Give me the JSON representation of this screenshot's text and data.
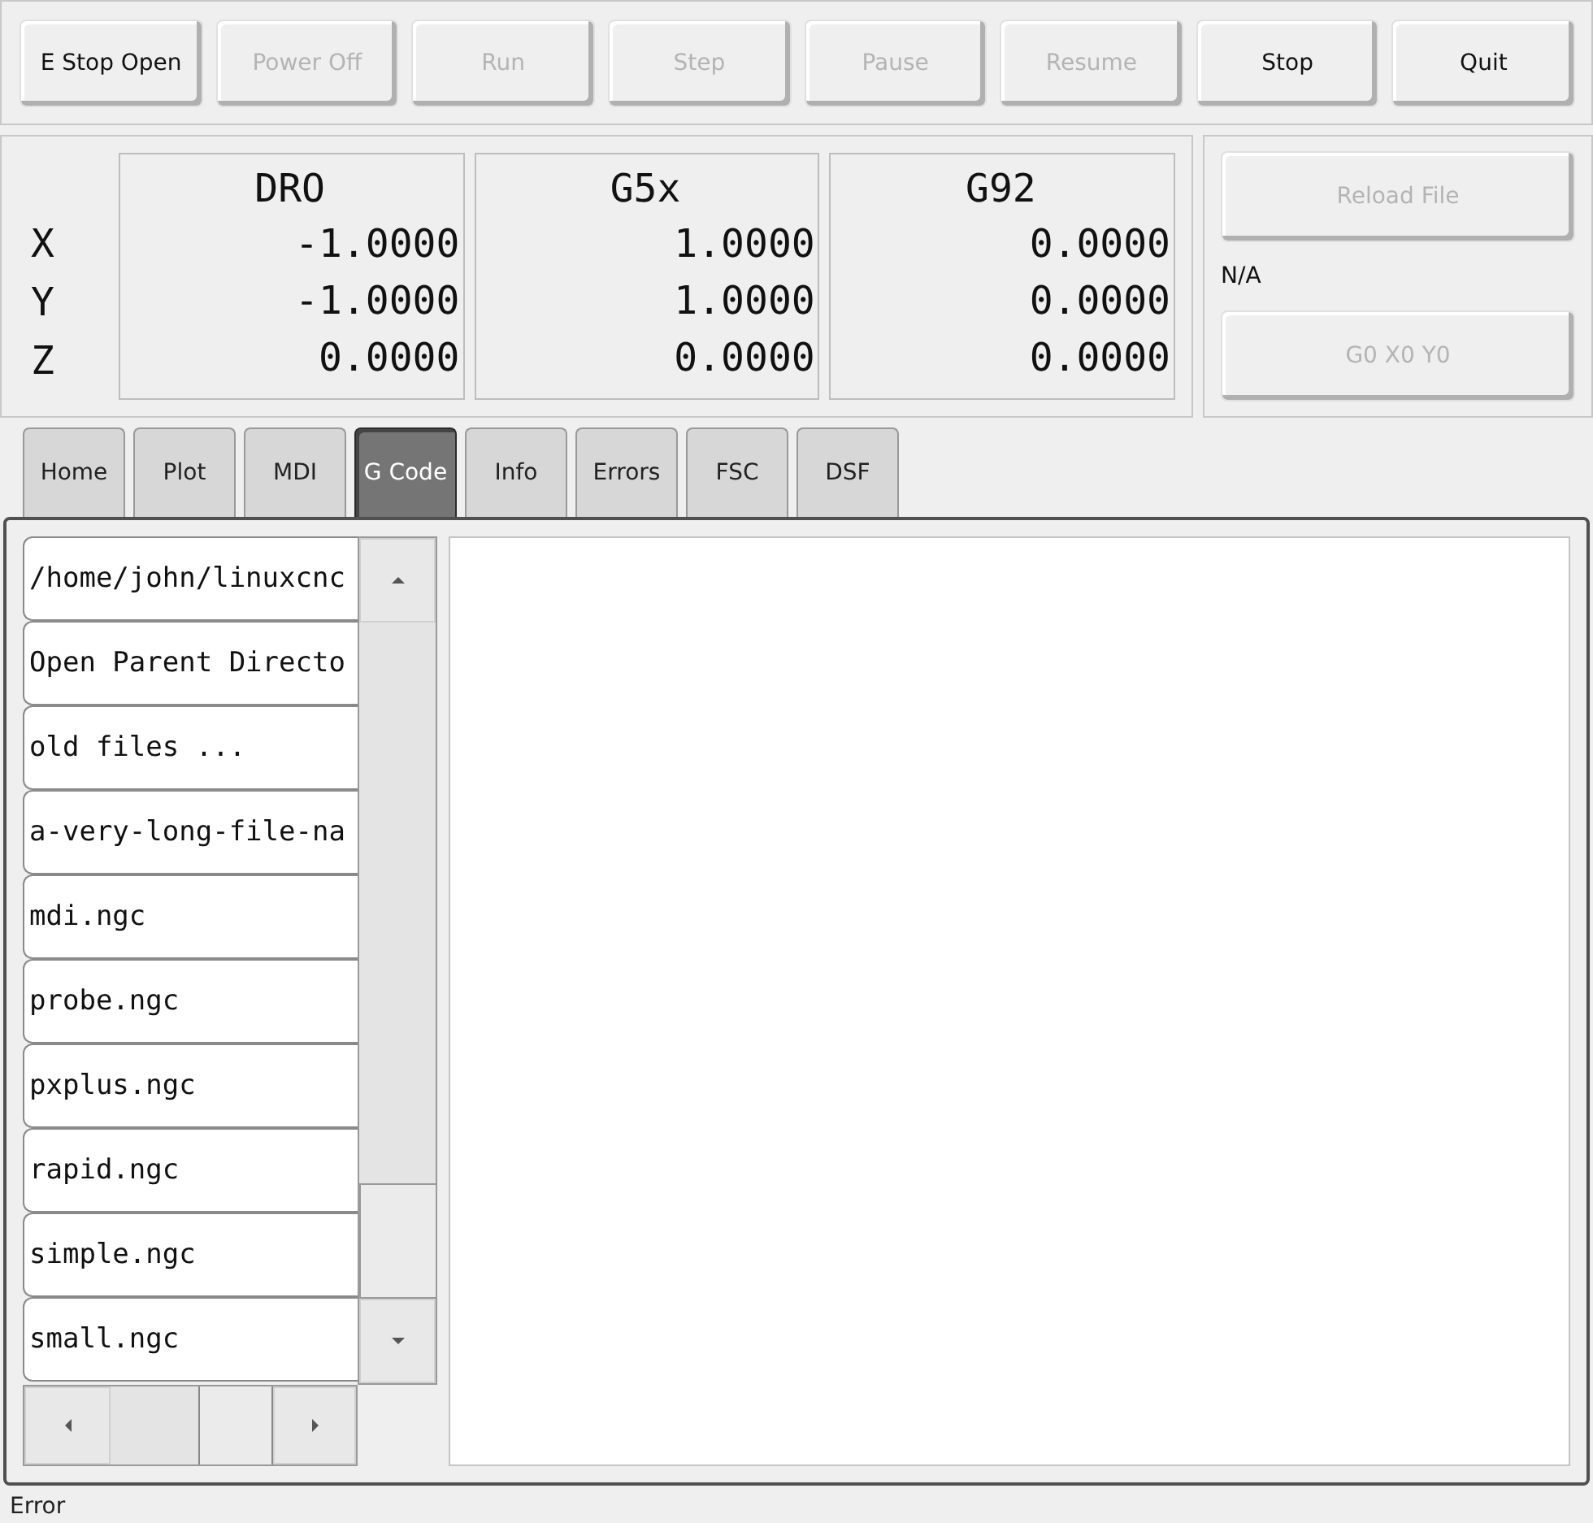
{
  "toolbar": [
    {
      "label": "E Stop Open",
      "disabled": false
    },
    {
      "label": "Power Off",
      "disabled": true
    },
    {
      "label": "Run",
      "disabled": true
    },
    {
      "label": "Step",
      "disabled": true
    },
    {
      "label": "Pause",
      "disabled": true
    },
    {
      "label": "Resume",
      "disabled": true
    },
    {
      "label": "Stop",
      "disabled": false
    },
    {
      "label": "Quit",
      "disabled": false
    }
  ],
  "dro": {
    "axes": [
      "X",
      "Y",
      "Z"
    ],
    "columns": [
      {
        "title": "DRO",
        "values": [
          "-1.0000",
          "-1.0000",
          "0.0000"
        ]
      },
      {
        "title": "G5x",
        "values": [
          "1.0000",
          "1.0000",
          "0.0000"
        ]
      },
      {
        "title": "G92",
        "values": [
          "0.0000",
          "0.0000",
          "0.0000"
        ]
      }
    ]
  },
  "side_panel": {
    "reload_button": {
      "label": "Reload File",
      "disabled": true
    },
    "file_label": "N/A",
    "goto_button": {
      "label": "G0 X0 Y0",
      "disabled": true
    }
  },
  "tabs": [
    {
      "label": "Home",
      "selected": false
    },
    {
      "label": "Plot",
      "selected": false
    },
    {
      "label": "MDI",
      "selected": false
    },
    {
      "label": "G Code",
      "selected": true
    },
    {
      "label": "Info",
      "selected": false
    },
    {
      "label": "Errors",
      "selected": false
    },
    {
      "label": "FSC",
      "selected": false
    },
    {
      "label": "DSF",
      "selected": false
    }
  ],
  "file_list": [
    "/home/john/linuxcnc",
    "Open Parent Directo",
    "old files ...",
    "a-very-long-file-na",
    "mdi.ngc",
    "probe.ngc",
    "pxplus.ngc",
    "rapid.ngc",
    "simple.ngc",
    "small.ngc"
  ],
  "status_bar": "Error"
}
